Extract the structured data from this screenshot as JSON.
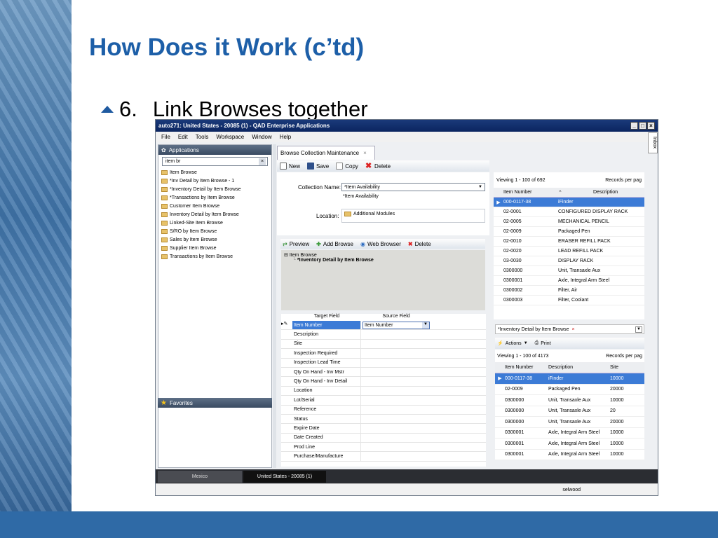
{
  "slide": {
    "title": "How Does it Work (c’td)",
    "bullet_number": "6.",
    "bullet_text": "Link Browses together"
  },
  "window": {
    "title": "auto271: United States - 20085 (1) - QAD Enterprise Applications",
    "min": "_",
    "max": "□",
    "close": "×",
    "inbox": "Inbox"
  },
  "menu": [
    "File",
    "Edit",
    "Tools",
    "Workspace",
    "Window",
    "Help"
  ],
  "applications": {
    "header": "Applications",
    "search_value": "item br",
    "items": [
      "Item Browse",
      "*Inv Detail by Item Browse - 1",
      "*Inventory Detail by Item Browse",
      "*Transactions by Item Browse",
      "Customer Item Browse",
      "Inventory Detail by Item Browse",
      "Linked-Site Item Browse",
      "S/RO by Item Browse",
      "Sales by Item Browse",
      "Supplier Item Browse",
      "Transactions by Item Browse"
    ]
  },
  "favorites": {
    "header": "Favorites"
  },
  "tab": {
    "label": "Browse Collection Maintenance",
    "close": "×"
  },
  "toolbar": {
    "new": "New",
    "save": "Save",
    "copy": "Copy",
    "delete": "Delete"
  },
  "form": {
    "collection_label": "Collection Name:",
    "collection_value": "*Item Availability",
    "collection_desc": "*Item Availability",
    "location_label": "Location:",
    "location_value": "Additional Modules"
  },
  "tree_toolbar": {
    "preview": "Preview",
    "add_browse": "Add Browse",
    "web_browser": "Web Browser",
    "delete": "Delete"
  },
  "tree": {
    "root": "Item Browse",
    "child": "*Inventory Detail by Item Browse"
  },
  "field_grid": {
    "col_target": "Target Field",
    "col_source": "Source Field",
    "source_value": "Item Number",
    "rows": [
      "Item Number",
      "Description",
      "Site",
      "Inspection Required",
      "Inspection Lead Time",
      "Qty On Hand - Inv Mstr",
      "Qty On Hand - Inv Detail",
      "Location",
      "Lot/Serial",
      "Reference",
      "Status",
      "Expire Date",
      "Date Created",
      "Prod Line",
      "Purchase/Manufacture"
    ]
  },
  "item_browse": {
    "viewing": "Viewing 1 - 100 of 692",
    "records_per_page": "Records per pag",
    "col_item": "Item Number",
    "col_desc": "Description",
    "rows": [
      {
        "item": "000-0117-38",
        "desc": "iFinder"
      },
      {
        "item": "02-0001",
        "desc": "CONFIGURED DISPLAY RACK"
      },
      {
        "item": "02-0005",
        "desc": "MECHANICAL PENCIL"
      },
      {
        "item": "02-0009",
        "desc": "Packaged Pen"
      },
      {
        "item": "02-0010",
        "desc": "ERASER REFILL PACK"
      },
      {
        "item": "02-0020",
        "desc": "LEAD REFILL PACK"
      },
      {
        "item": "03-0030",
        "desc": "DISPLAY RACK"
      },
      {
        "item": "0300000",
        "desc": "Unit, Transaxle Aux"
      },
      {
        "item": "0300001",
        "desc": "Axle, Integral Arm Steel"
      },
      {
        "item": "0300002",
        "desc": "Filter, Air"
      },
      {
        "item": "0300003",
        "desc": "Filter, Coolant"
      }
    ]
  },
  "detail_browse": {
    "tab_label": "*Inventory Detail by Item Browse",
    "actions": "Actions",
    "print": "Print",
    "viewing": "Viewing 1 - 100 of 4173",
    "records_per_page": "Records per pag",
    "col_item": "Item Number",
    "col_desc": "Description",
    "col_site": "Site",
    "rows": [
      {
        "item": "000-0117-38",
        "desc": "iFinder",
        "site": "10000"
      },
      {
        "item": "02-0009",
        "desc": "Packaged Pen",
        "site": "20000"
      },
      {
        "item": "0300000",
        "desc": "Unit, Transaxle Aux",
        "site": "10000"
      },
      {
        "item": "0300000",
        "desc": "Unit, Transaxle Aux",
        "site": "20"
      },
      {
        "item": "0300000",
        "desc": "Unit, Transaxle Aux",
        "site": "20000"
      },
      {
        "item": "0300001",
        "desc": "Axle, Integral Arm Steel",
        "site": "10000"
      },
      {
        "item": "0300001",
        "desc": "Axle, Integral Arm Steel",
        "site": "10000"
      },
      {
        "item": "0300001",
        "desc": "Axle, Integral Arm Steel",
        "site": "10000"
      }
    ]
  },
  "taskbar": {
    "task1": "Mexico",
    "task2": "United States - 20085 (1)"
  },
  "status": {
    "user": "selwood"
  }
}
